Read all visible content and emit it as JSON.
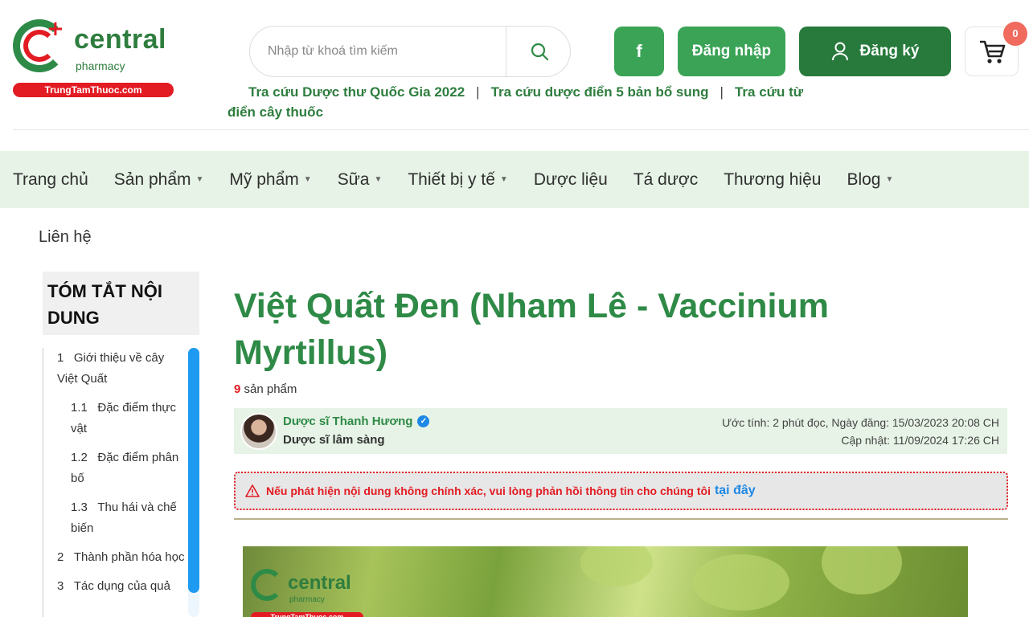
{
  "brand": {
    "name": "central",
    "sub": "pharmacy",
    "site": "TrungTamThuoc.com"
  },
  "search": {
    "placeholder": "Nhập từ khoá tìm kiếm"
  },
  "header": {
    "facebook_label": "f",
    "login_label": "Đăng nhập",
    "register_label": "Đăng ký",
    "cart_count": "0"
  },
  "quick_links": [
    {
      "label": "Tra cứu Dược thư Quốc Gia 2022"
    },
    {
      "label": "Tra cứu dược điển 5 bản bổ sung"
    },
    {
      "label": "Tra cứu từ điển cây thuốc"
    }
  ],
  "nav": {
    "items": [
      {
        "label": "Trang chủ"
      },
      {
        "label": "Sản phẩm"
      },
      {
        "label": "Mỹ phẩm"
      },
      {
        "label": "Sữa"
      },
      {
        "label": "Thiết bị y tế"
      },
      {
        "label": "Dược liệu"
      },
      {
        "label": "Tá dược"
      },
      {
        "label": "Thương hiệu"
      },
      {
        "label": "Blog"
      }
    ]
  },
  "breadcrumb": {
    "label": "Liên hệ"
  },
  "toc": {
    "title": "TÓM TẮT NỘI DUNG",
    "items": [
      {
        "num": "1",
        "label": "Giới thiệu về cây Việt Quất"
      },
      {
        "num": "1.1",
        "label": "Đặc điểm thực vật"
      },
      {
        "num": "1.2",
        "label": "Đặc điểm phân bố"
      },
      {
        "num": "1.3",
        "label": "Thu hái và chế biến"
      },
      {
        "num": "2",
        "label": "Thành phần hóa học"
      },
      {
        "num": "3",
        "label": "Tác dụng của quả"
      }
    ]
  },
  "article": {
    "title": "Việt Quất Đen (Nham Lê - Vaccinium Myrtillus)",
    "product_count": "9",
    "product_label": "sản phẩm",
    "author_name": "Dược sĩ Thanh Hương",
    "author_role": "Dược sĩ lâm sàng",
    "meta_line1": "Ước tính: 2 phút đọc, Ngày đăng: 15/03/2023 20:08 CH",
    "meta_line2": "Cập nhật: 11/09/2024 17:26 CH",
    "notice_text": "Nếu phát hiện nội dung không chính xác, vui lòng phản hồi thông tin cho chúng tôi",
    "notice_link": "tại đây"
  }
}
